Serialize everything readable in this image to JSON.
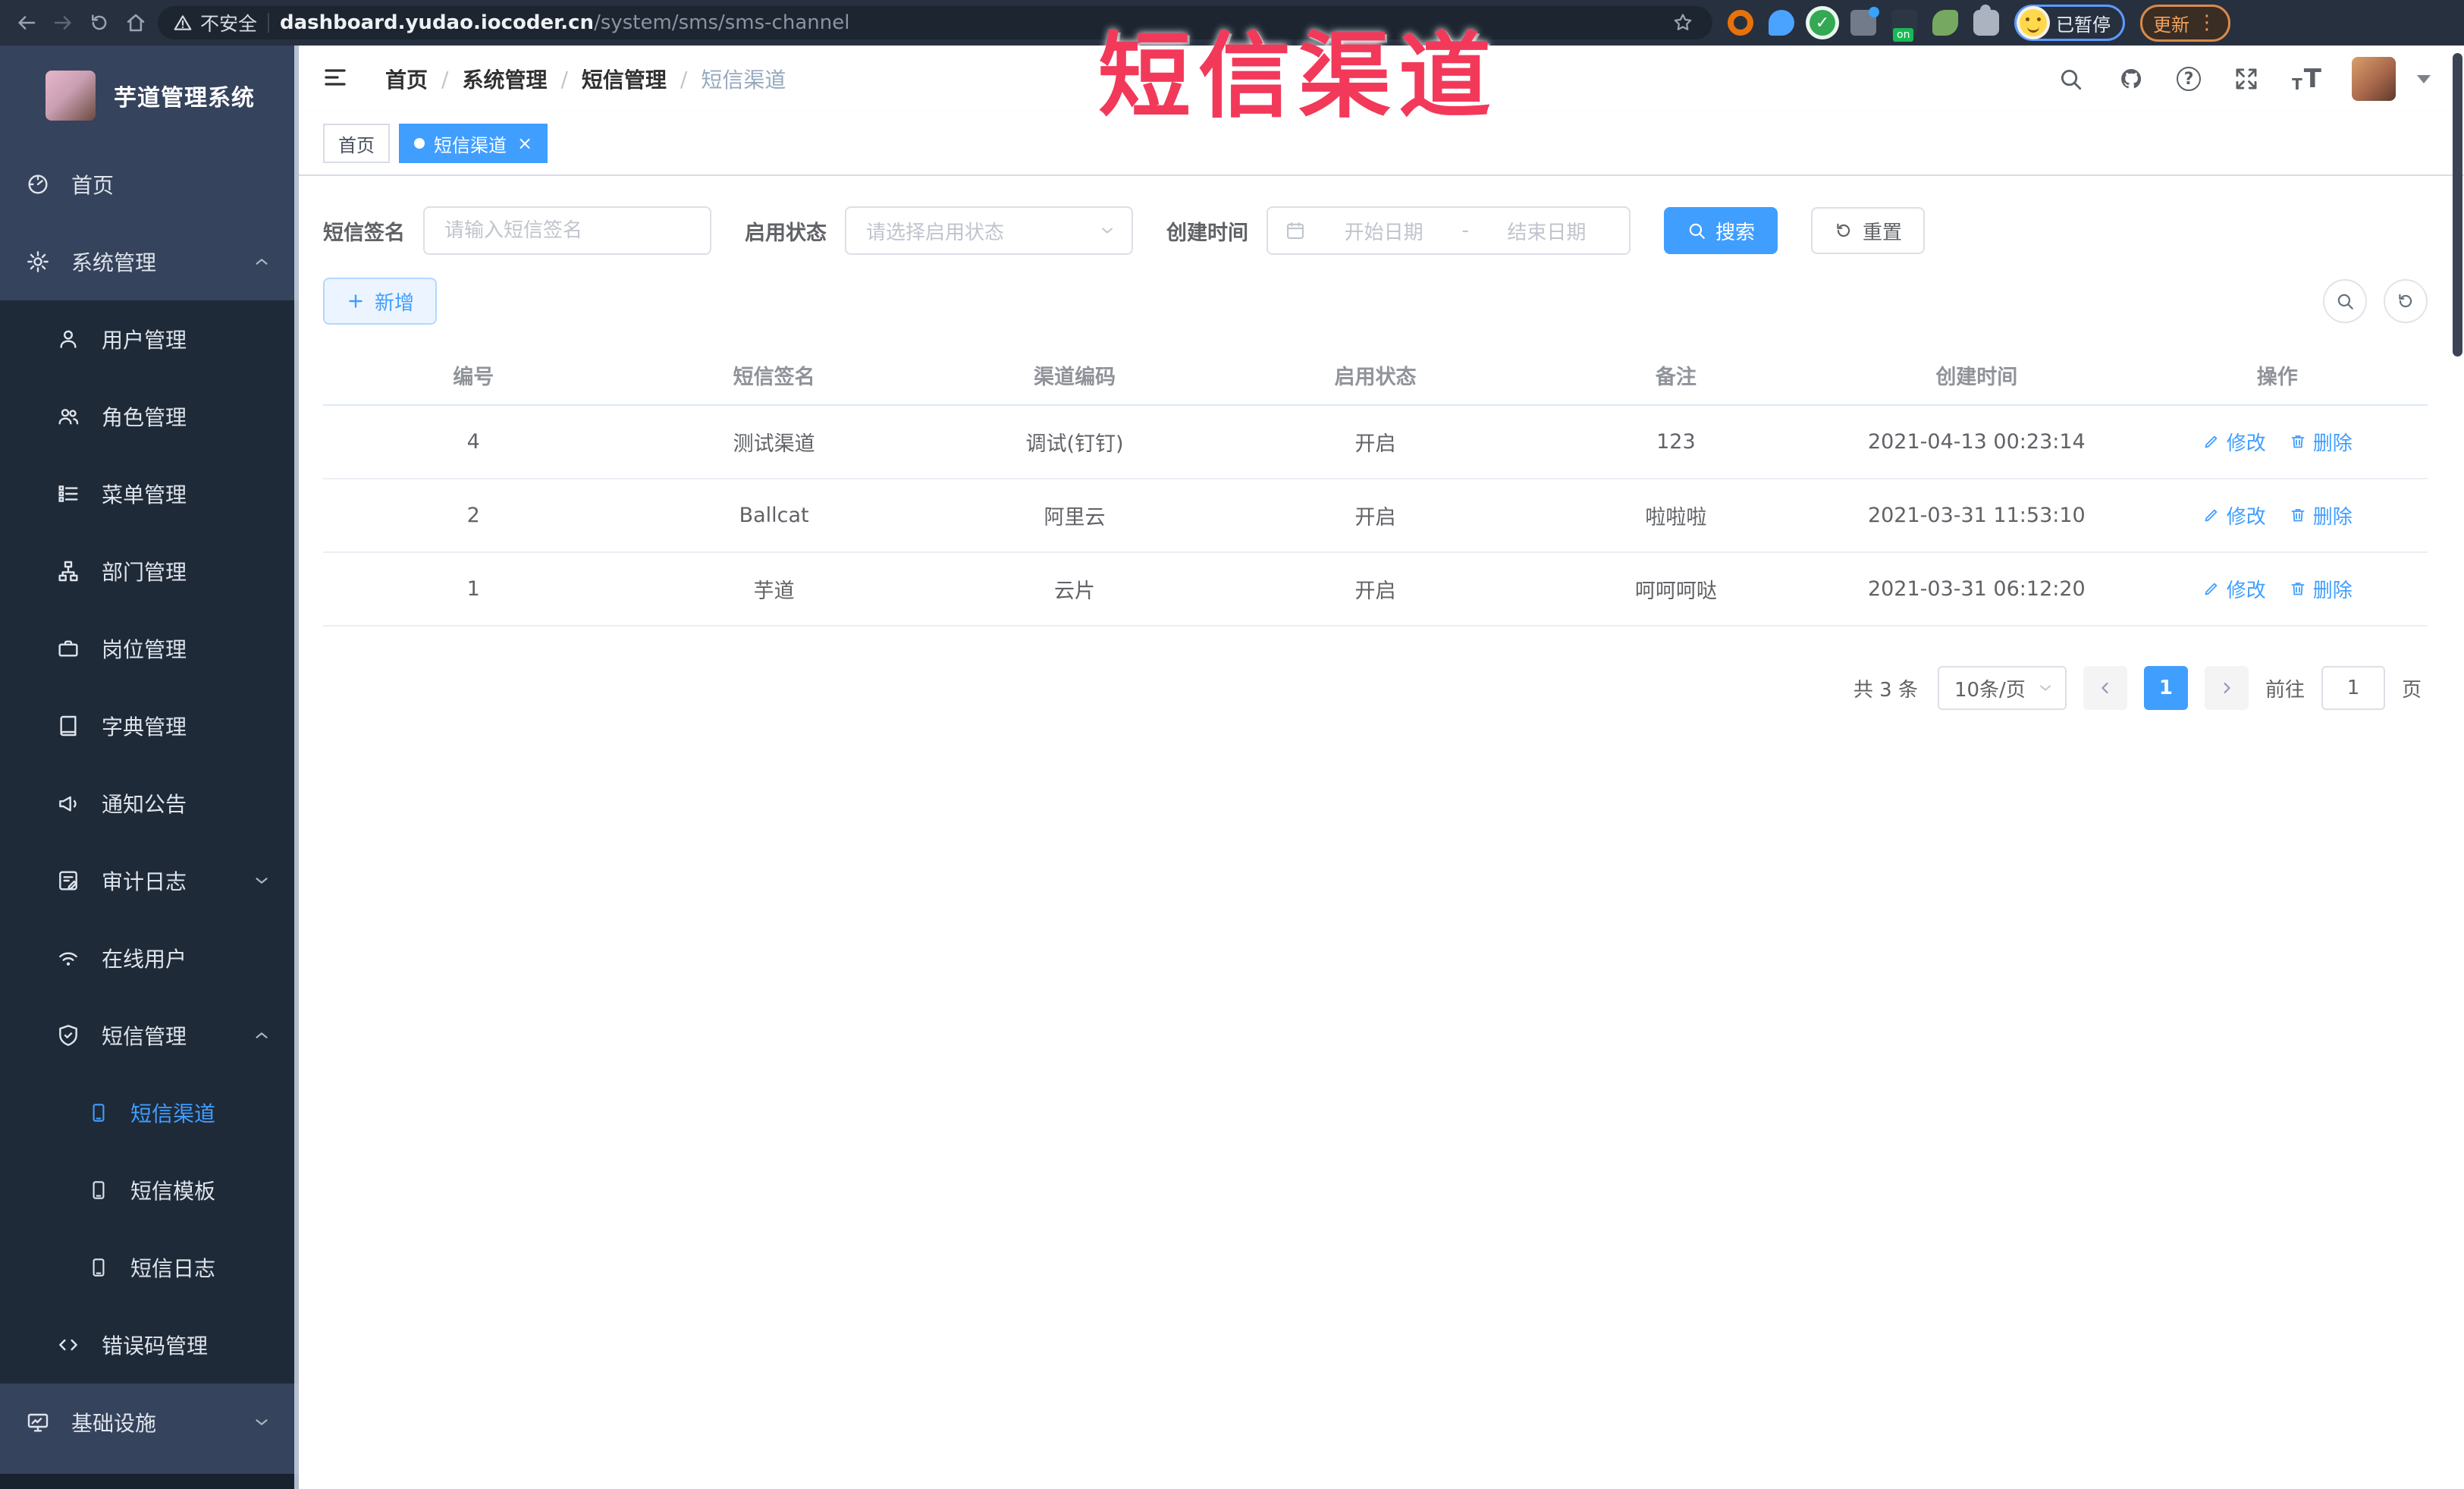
{
  "browser": {
    "security_label": "不安全",
    "url_host": "dashboard.yudao.iocoder.cn",
    "url_path": "/system/sms/sms-channel",
    "paused_badge": "已暂停",
    "update_button": "更新"
  },
  "watermark": {
    "text": "短信渠道",
    "color": "#f2395a"
  },
  "sidebar": {
    "app_title": "芋道管理系统",
    "items": [
      {
        "label": "首页",
        "icon": "dashboard-icon",
        "level": 1
      },
      {
        "label": "系统管理",
        "icon": "gear-icon",
        "level": 1,
        "expanded": true
      },
      {
        "label": "用户管理",
        "icon": "user-icon",
        "level": 2
      },
      {
        "label": "角色管理",
        "icon": "users-icon",
        "level": 2
      },
      {
        "label": "菜单管理",
        "icon": "menu-list-icon",
        "level": 2
      },
      {
        "label": "部门管理",
        "icon": "org-tree-icon",
        "level": 2
      },
      {
        "label": "岗位管理",
        "icon": "briefcase-icon",
        "level": 2
      },
      {
        "label": "字典管理",
        "icon": "dictionary-icon",
        "level": 2
      },
      {
        "label": "通知公告",
        "icon": "megaphone-icon",
        "level": 2
      },
      {
        "label": "审计日志",
        "icon": "audit-log-icon",
        "level": 2,
        "collapsed": true
      },
      {
        "label": "在线用户",
        "icon": "online-users-icon",
        "level": 2
      },
      {
        "label": "短信管理",
        "icon": "sms-shield-icon",
        "level": 2,
        "expanded": true
      },
      {
        "label": "短信渠道",
        "icon": "phone-icon",
        "level": 3,
        "active": true
      },
      {
        "label": "短信模板",
        "icon": "phone-icon",
        "level": 3
      },
      {
        "label": "短信日志",
        "icon": "phone-icon",
        "level": 3
      },
      {
        "label": "错误码管理",
        "icon": "code-icon",
        "level": 2
      },
      {
        "label": "基础设施",
        "icon": "monitor-icon",
        "level": 1,
        "collapsed": true
      }
    ]
  },
  "breadcrumb": {
    "items": [
      "首页",
      "系统管理",
      "短信管理",
      "短信渠道"
    ],
    "separator": "/"
  },
  "tabs": [
    {
      "label": "首页",
      "active": false
    },
    {
      "label": "短信渠道",
      "active": true,
      "closable": true
    }
  ],
  "filters": {
    "sign_label": "短信签名",
    "sign_placeholder": "请输入短信签名",
    "status_label": "启用状态",
    "status_placeholder": "请选择启用状态",
    "time_label": "创建时间",
    "start_placeholder": "开始日期",
    "range_separator": "-",
    "end_placeholder": "结束日期",
    "search_button": "搜索",
    "reset_button": "重置"
  },
  "toolbar": {
    "add_button": "新增"
  },
  "table": {
    "columns": [
      "编号",
      "短信签名",
      "渠道编码",
      "启用状态",
      "备注",
      "创建时间",
      "操作"
    ],
    "rows": [
      {
        "id": "4",
        "sign": "测试渠道",
        "code": "调试(钉钉)",
        "status": "开启",
        "remark": "123",
        "created": "2021-04-13 00:23:14"
      },
      {
        "id": "2",
        "sign": "Ballcat",
        "code": "阿里云",
        "status": "开启",
        "remark": "啦啦啦",
        "created": "2021-03-31 11:53:10"
      },
      {
        "id": "1",
        "sign": "芋道",
        "code": "云片",
        "status": "开启",
        "remark": "呵呵呵哒",
        "created": "2021-03-31 06:12:20"
      }
    ],
    "edit_label": "修改",
    "delete_label": "删除"
  },
  "pagination": {
    "total_text": "共 3 条",
    "page_size": "10条/页",
    "current_page": "1",
    "goto_label": "前往",
    "goto_value": "1",
    "page_unit": "页"
  },
  "colors": {
    "accent": "#409eff",
    "annotation_red": "#f2395a",
    "sidebar_dark": "#1f2a38",
    "sidebar_light": "#35435c"
  }
}
